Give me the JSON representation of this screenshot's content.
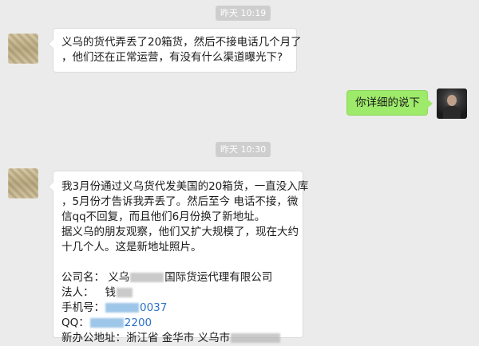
{
  "timestamps": {
    "first": "昨天 10:19",
    "second": "昨天 10:30"
  },
  "messages": {
    "first": {
      "line1": "义乌的货代弄丢了20箱货，然后不接电话几个月了",
      "line2": "，他们还在正常运营，有没有什么渠道曝光下?"
    },
    "reply": {
      "text": "你详细的说下"
    },
    "second": {
      "line1": "我3月份通过义乌货代发美国的20箱货，一直没入库",
      "line2": "，5月份才告诉我弄丢了。然后至今 电话不接，微",
      "line3": "信qq不回复，而且他们6月份换了新地址。",
      "line4": "据义乌的朋友观察，他们又扩大规模了，现在大约",
      "line5": "十几个人。这是新地址照片。",
      "company_label": "公司名：",
      "company_prefix": "义乌",
      "company_suffix": "国际货运代理有限公司",
      "legal_label": "法人：",
      "legal_prefix": "钱",
      "phone_label": "手机号：",
      "phone_suffix": "0037",
      "qq_label": "QQ：",
      "qq_suffix": "2200",
      "address_label": "新办公地址：",
      "address_prefix": "浙江省 金华市 义乌市"
    }
  },
  "colors": {
    "background": "#ebebeb",
    "incoming_bubble": "#ffffff",
    "outgoing_bubble": "#9eea6a",
    "timestamp_bg": "#cecece",
    "link_blue": "#2d73c8"
  }
}
